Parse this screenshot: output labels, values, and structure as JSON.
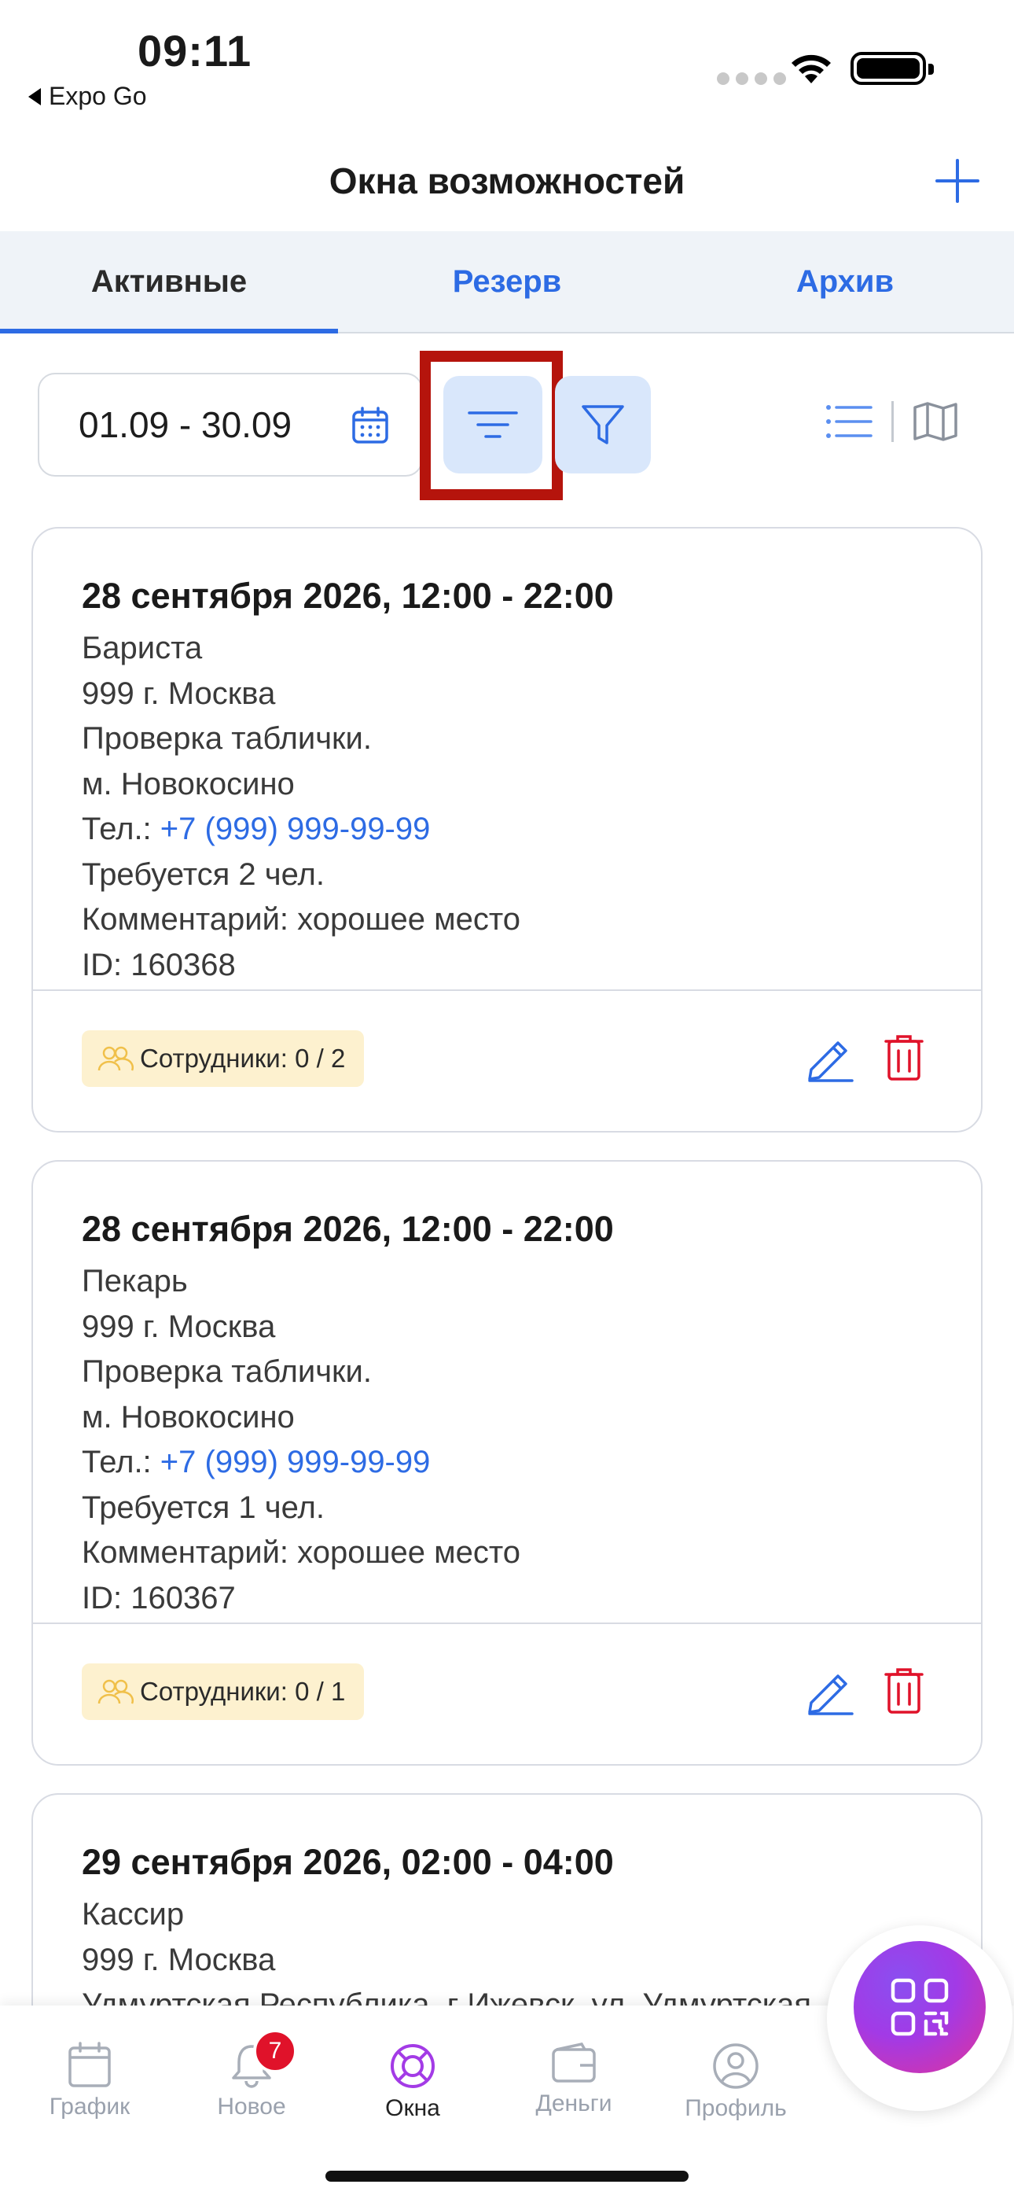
{
  "status_bar": {
    "time": "09:11",
    "back_app": "Expo Go"
  },
  "header": {
    "title": "Окна возможностей"
  },
  "tabs": [
    {
      "label": "Активные",
      "active": true
    },
    {
      "label": "Резерв",
      "active": false
    },
    {
      "label": "Архив",
      "active": false
    }
  ],
  "toolbar": {
    "date_range": "01.09 - 30.09"
  },
  "cards": [
    {
      "title": "28 сентября 2026, 12:00 - 22:00",
      "position": "Бариста",
      "address": "999 г. Москва",
      "note": "Проверка таблички.",
      "metro": "м. Новокосино",
      "phone_prefix": "Тел.:",
      "phone": "+7 (999) 999-99-99",
      "required": "Требуется 2 чел.",
      "comment": "Комментарий: хорошее место",
      "id": "ID: 160368",
      "staff": "Сотрудники: 0 / 2"
    },
    {
      "title": "28 сентября 2026, 12:00 - 22:00",
      "position": "Пекарь",
      "address": "999 г. Москва",
      "note": "Проверка таблички.",
      "metro": "м. Новокосино",
      "phone_prefix": "Тел.:",
      "phone": "+7 (999) 999-99-99",
      "required": "Требуется 1 чел.",
      "comment": "Комментарий: хорошее место",
      "id": "ID: 160367",
      "staff": "Сотрудники: 0 / 1"
    },
    {
      "title": "29 сентября 2026, 02:00 - 04:00",
      "position": "Кассир",
      "address": "999 г. Москва",
      "note": "Удмуртская Республика, г Ижевск, ул. Удмуртская"
    }
  ],
  "bottom_nav": [
    {
      "label": "График",
      "icon": "calendar-icon"
    },
    {
      "label": "Новое",
      "icon": "bell-icon",
      "badge": "7"
    },
    {
      "label": "Окна",
      "icon": "lifebuoy-icon",
      "active": true
    },
    {
      "label": "Деньги",
      "icon": "wallet-icon"
    },
    {
      "label": "Профиль",
      "icon": "profile-icon"
    }
  ],
  "colors": {
    "accent": "#2d6be4",
    "danger": "#e0122a",
    "highlight_frame": "#b5140c",
    "badge_bg": "#fdf1cf"
  }
}
